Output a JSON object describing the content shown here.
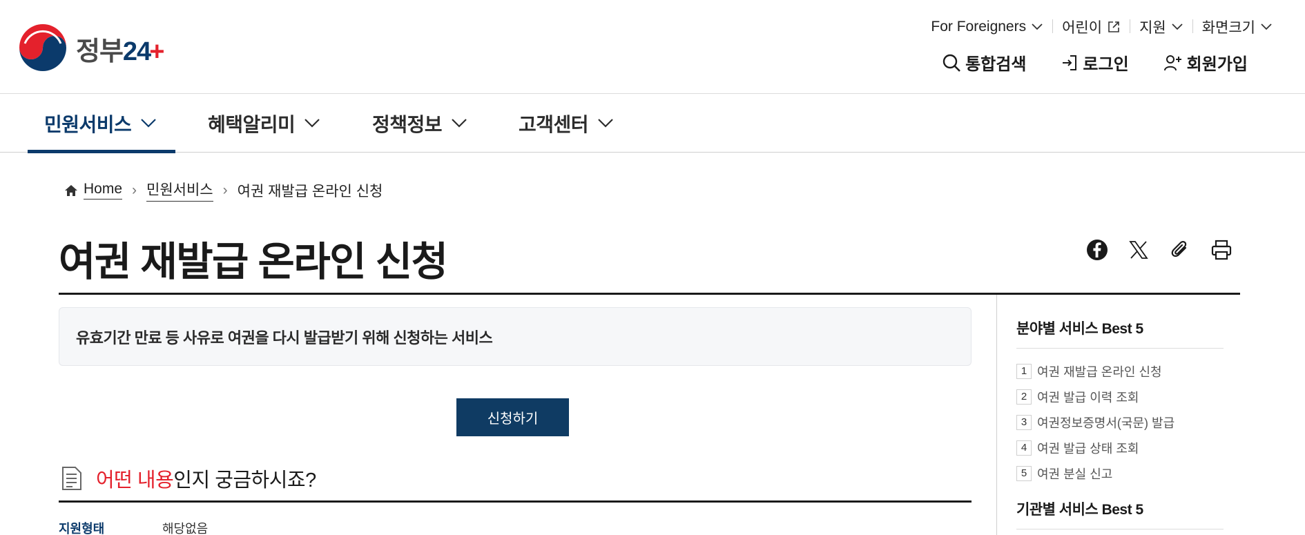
{
  "logo": {
    "text": "정부",
    "num": "24"
  },
  "util_menu": [
    {
      "label": "For Foreigners",
      "icon": "chevron-down-icon"
    },
    {
      "label": "어린이",
      "icon": "external-link-icon"
    },
    {
      "label": "지원",
      "icon": "chevron-down-icon"
    },
    {
      "label": "화면크기",
      "icon": "chevron-down-icon"
    }
  ],
  "member_menu": [
    {
      "label": "통합검색",
      "icon": "search-icon"
    },
    {
      "label": "로그인",
      "icon": "login-icon"
    },
    {
      "label": "회원가입",
      "icon": "user-add-icon"
    }
  ],
  "gnb": [
    {
      "label": "민원서비스",
      "active": true
    },
    {
      "label": "혜택알리미",
      "active": false
    },
    {
      "label": "정책정보",
      "active": false
    },
    {
      "label": "고객센터",
      "active": false
    }
  ],
  "breadcrumb": {
    "home": "Home",
    "level1": "민원서비스",
    "current": "여권 재발급 온라인 신청"
  },
  "page": {
    "title": "여권 재발급 온라인 신청",
    "summary": "유효기간 만료 등 사유로 여권을 다시 발급받기 위해 신청하는 서비스",
    "apply_label": "신청하기"
  },
  "section": {
    "title_red": "어떤 내용",
    "title_rest": "인지 궁금하시죠?"
  },
  "info": {
    "key": "지원형태",
    "value": "해당없음"
  },
  "share_icons": [
    "facebook-icon",
    "x-icon",
    "clip-icon",
    "print-icon"
  ],
  "aside": {
    "best_category_title": "분야별 서비스 Best 5",
    "best_category": [
      {
        "rank": "1",
        "label": "여권 재발급 온라인 신청"
      },
      {
        "rank": "2",
        "label": "여권 발급 이력 조회"
      },
      {
        "rank": "3",
        "label": "여권정보증명서(국문) 발급"
      },
      {
        "rank": "4",
        "label": "여권 발급 상태 조회"
      },
      {
        "rank": "5",
        "label": "여권 분실 신고"
      }
    ],
    "best_agency_title": "기관별 서비스 Best 5"
  },
  "colors": {
    "brand_navy": "#0b3a6b",
    "accent_red": "#e4212c",
    "button": "#0f3b63"
  }
}
